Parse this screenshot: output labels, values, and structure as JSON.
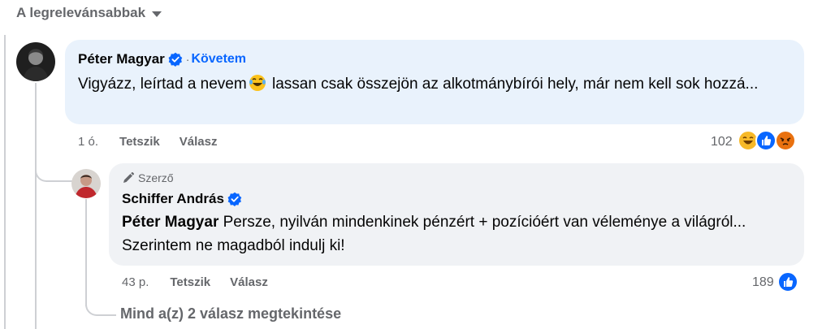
{
  "sort": {
    "label": "A legrelevánsabbak"
  },
  "comment": {
    "author": "Péter Magyar",
    "follow_label": "Követem",
    "text_before": "Vigyázz, leírtad a nevem",
    "text_after": " lassan csak összejön az alkotmánybírói hely, már nem kell sok hozzá...",
    "time": "1 ó.",
    "like_label": "Tetszik",
    "reply_label": "Válasz",
    "reaction_count": "102",
    "reactions": [
      "laugh-icon",
      "like-icon",
      "angry-icon"
    ]
  },
  "reply": {
    "author_tag": "Szerző",
    "author": "Schiffer András",
    "mention": "Péter Magyar",
    "text": " Persze, nyilván mindenkinek pénzért + pozícióért van véleménye a világról... Szerintem ne magadból indulj ki!",
    "time": "43 p.",
    "like_label": "Tetszik",
    "reply_label": "Válasz",
    "reaction_count": "189",
    "reactions": [
      "like-icon"
    ]
  },
  "view_replies": {
    "label": "Mind a(z) 2 válasz megtekintése"
  },
  "colors": {
    "accent": "#0866ff",
    "secondary_text": "#65676b",
    "bubble": "#f0f2f5",
    "highlight_bubble": "#e9f2fc"
  }
}
